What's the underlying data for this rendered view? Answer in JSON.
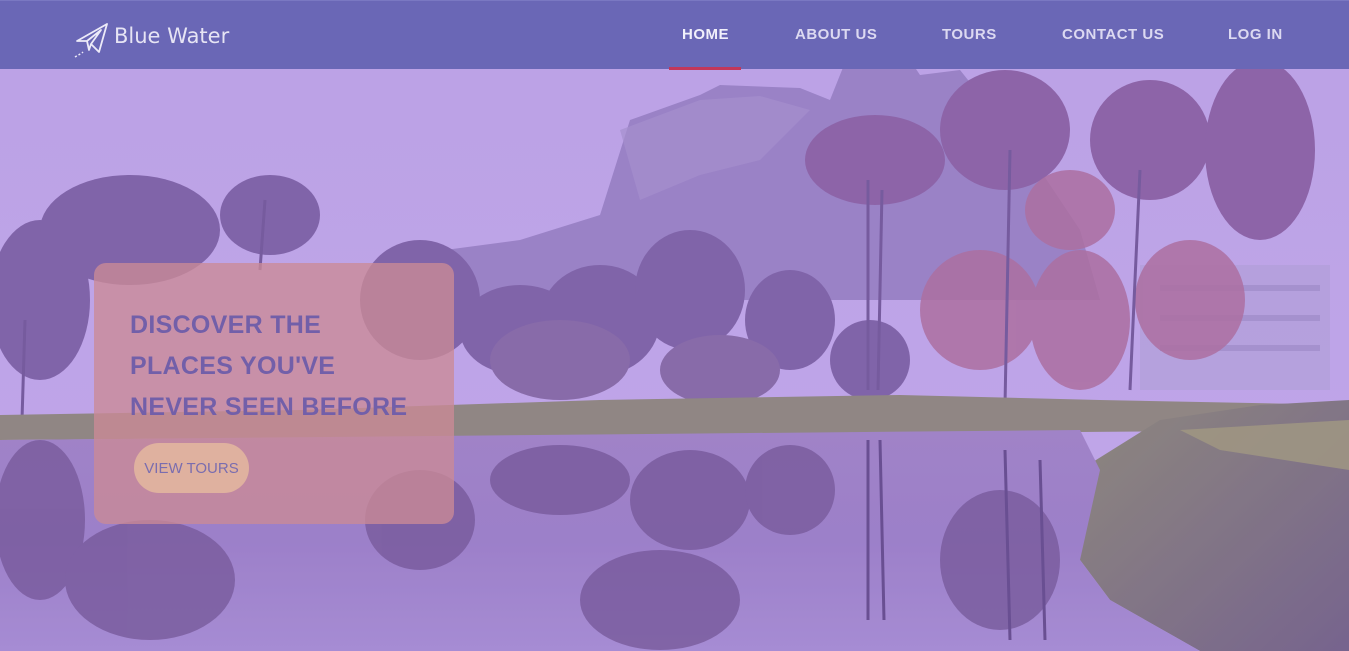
{
  "brand": {
    "name": "Blue Water",
    "icon": "paper-plane-icon"
  },
  "nav": {
    "items": [
      {
        "label": "HOME",
        "active": true
      },
      {
        "label": "ABOUT US",
        "active": false
      },
      {
        "label": "TOURS",
        "active": false
      },
      {
        "label": "CONTACT US",
        "active": false
      },
      {
        "label": "LOG IN",
        "active": false
      }
    ]
  },
  "hero": {
    "title": "DISCOVER THE PLACES YOU'VE NEVER SEEN BEFORE",
    "button_label": "VIEW TOURS"
  },
  "colors": {
    "navbar": "#6a67b6",
    "active_underline": "#c2375a",
    "overlay": "#9a7fd6",
    "card": "#cb8a96",
    "card_title": "#725fa9",
    "button": "#dfb19f"
  }
}
